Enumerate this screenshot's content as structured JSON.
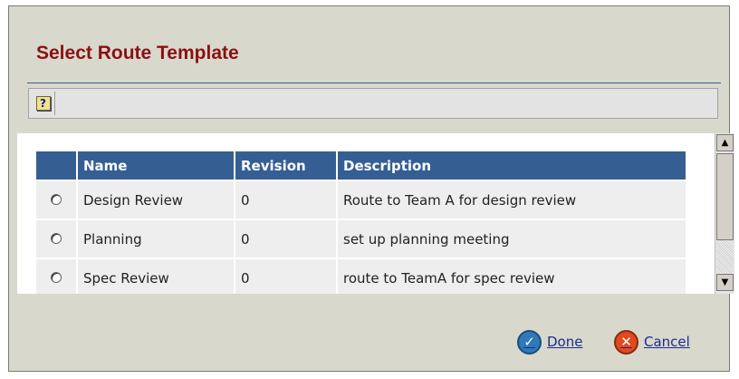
{
  "dialog": {
    "title": "Select Route Template",
    "toolbar": {
      "help_icon": "help-icon",
      "help_glyph": "?"
    },
    "table": {
      "columns": [
        "",
        "Name",
        "Revision",
        "Description"
      ],
      "rows": [
        {
          "name": "Design Review",
          "revision": "0",
          "description": "Route to Team A for design review"
        },
        {
          "name": "Planning",
          "revision": "0",
          "description": "set up planning meeting"
        },
        {
          "name": "Spec Review",
          "revision": "0",
          "description": "route to TeamA for spec review"
        }
      ]
    },
    "buttons": {
      "done": "Done",
      "cancel": "Cancel"
    }
  },
  "colors": {
    "title": "#8b1111",
    "header_bg": "#355f93",
    "link": "#1a2e8c",
    "done_icon": "#2f79b8",
    "cancel_icon": "#e04a1e"
  }
}
